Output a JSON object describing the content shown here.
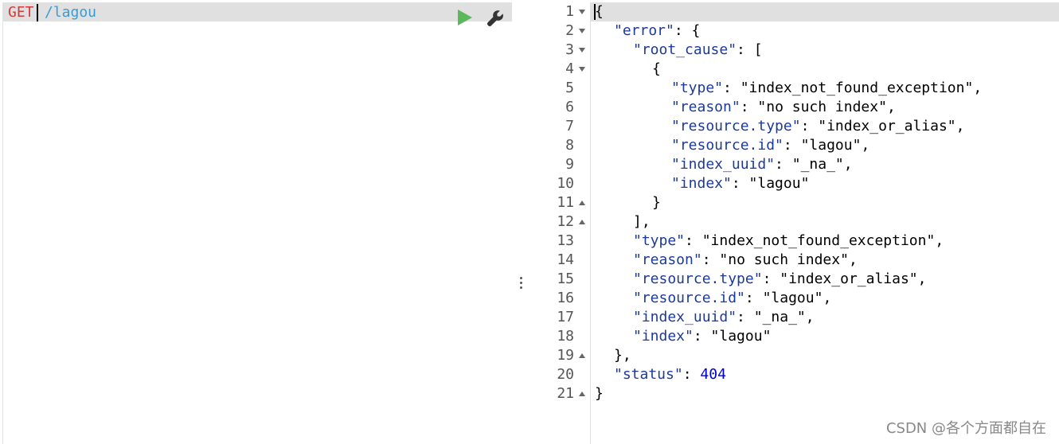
{
  "request": {
    "method": "GET",
    "path": "/lagou"
  },
  "icons": {
    "run": "play-icon",
    "settings": "wrench-icon",
    "run_color": "#5cb85c"
  },
  "response": {
    "lines": [
      {
        "num": "1",
        "fold": "down",
        "indent": 0,
        "parts": [
          {
            "t": "p",
            "v": "{"
          }
        ]
      },
      {
        "num": "2",
        "fold": "down",
        "indent": 1,
        "parts": [
          {
            "t": "k",
            "v": "\"error\""
          },
          {
            "t": "p",
            "v": ": {"
          }
        ]
      },
      {
        "num": "3",
        "fold": "down",
        "indent": 2,
        "parts": [
          {
            "t": "k",
            "v": "\"root_cause\""
          },
          {
            "t": "p",
            "v": ": ["
          }
        ]
      },
      {
        "num": "4",
        "fold": "down",
        "indent": 3,
        "parts": [
          {
            "t": "p",
            "v": "{"
          }
        ]
      },
      {
        "num": "5",
        "fold": "",
        "indent": 4,
        "parts": [
          {
            "t": "k",
            "v": "\"type\""
          },
          {
            "t": "p",
            "v": ": "
          },
          {
            "t": "s",
            "v": "\"index_not_found_exception\""
          },
          {
            "t": "p",
            "v": ","
          }
        ]
      },
      {
        "num": "6",
        "fold": "",
        "indent": 4,
        "parts": [
          {
            "t": "k",
            "v": "\"reason\""
          },
          {
            "t": "p",
            "v": ": "
          },
          {
            "t": "s",
            "v": "\"no such index\""
          },
          {
            "t": "p",
            "v": ","
          }
        ]
      },
      {
        "num": "7",
        "fold": "",
        "indent": 4,
        "parts": [
          {
            "t": "k",
            "v": "\"resource.type\""
          },
          {
            "t": "p",
            "v": ": "
          },
          {
            "t": "s",
            "v": "\"index_or_alias\""
          },
          {
            "t": "p",
            "v": ","
          }
        ]
      },
      {
        "num": "8",
        "fold": "",
        "indent": 4,
        "parts": [
          {
            "t": "k",
            "v": "\"resource.id\""
          },
          {
            "t": "p",
            "v": ": "
          },
          {
            "t": "s",
            "v": "\"lagou\""
          },
          {
            "t": "p",
            "v": ","
          }
        ]
      },
      {
        "num": "9",
        "fold": "",
        "indent": 4,
        "parts": [
          {
            "t": "k",
            "v": "\"index_uuid\""
          },
          {
            "t": "p",
            "v": ": "
          },
          {
            "t": "s",
            "v": "\"_na_\""
          },
          {
            "t": "p",
            "v": ","
          }
        ]
      },
      {
        "num": "10",
        "fold": "",
        "indent": 4,
        "parts": [
          {
            "t": "k",
            "v": "\"index\""
          },
          {
            "t": "p",
            "v": ": "
          },
          {
            "t": "s",
            "v": "\"lagou\""
          }
        ]
      },
      {
        "num": "11",
        "fold": "up",
        "indent": 3,
        "parts": [
          {
            "t": "p",
            "v": "}"
          }
        ]
      },
      {
        "num": "12",
        "fold": "up",
        "indent": 2,
        "parts": [
          {
            "t": "p",
            "v": "],"
          }
        ]
      },
      {
        "num": "13",
        "fold": "",
        "indent": 2,
        "parts": [
          {
            "t": "k",
            "v": "\"type\""
          },
          {
            "t": "p",
            "v": ": "
          },
          {
            "t": "s",
            "v": "\"index_not_found_exception\""
          },
          {
            "t": "p",
            "v": ","
          }
        ]
      },
      {
        "num": "14",
        "fold": "",
        "indent": 2,
        "parts": [
          {
            "t": "k",
            "v": "\"reason\""
          },
          {
            "t": "p",
            "v": ": "
          },
          {
            "t": "s",
            "v": "\"no such index\""
          },
          {
            "t": "p",
            "v": ","
          }
        ]
      },
      {
        "num": "15",
        "fold": "",
        "indent": 2,
        "parts": [
          {
            "t": "k",
            "v": "\"resource.type\""
          },
          {
            "t": "p",
            "v": ": "
          },
          {
            "t": "s",
            "v": "\"index_or_alias\""
          },
          {
            "t": "p",
            "v": ","
          }
        ]
      },
      {
        "num": "16",
        "fold": "",
        "indent": 2,
        "parts": [
          {
            "t": "k",
            "v": "\"resource.id\""
          },
          {
            "t": "p",
            "v": ": "
          },
          {
            "t": "s",
            "v": "\"lagou\""
          },
          {
            "t": "p",
            "v": ","
          }
        ]
      },
      {
        "num": "17",
        "fold": "",
        "indent": 2,
        "parts": [
          {
            "t": "k",
            "v": "\"index_uuid\""
          },
          {
            "t": "p",
            "v": ": "
          },
          {
            "t": "s",
            "v": "\"_na_\""
          },
          {
            "t": "p",
            "v": ","
          }
        ]
      },
      {
        "num": "18",
        "fold": "",
        "indent": 2,
        "parts": [
          {
            "t": "k",
            "v": "\"index\""
          },
          {
            "t": "p",
            "v": ": "
          },
          {
            "t": "s",
            "v": "\"lagou\""
          }
        ]
      },
      {
        "num": "19",
        "fold": "up",
        "indent": 1,
        "parts": [
          {
            "t": "p",
            "v": "},"
          }
        ]
      },
      {
        "num": "20",
        "fold": "",
        "indent": 1,
        "parts": [
          {
            "t": "k",
            "v": "\"status\""
          },
          {
            "t": "p",
            "v": ": "
          },
          {
            "t": "n",
            "v": "404"
          }
        ]
      },
      {
        "num": "21",
        "fold": "up",
        "indent": 0,
        "parts": [
          {
            "t": "p",
            "v": "}"
          }
        ]
      }
    ]
  },
  "watermark": "CSDN @各个方面都自在"
}
